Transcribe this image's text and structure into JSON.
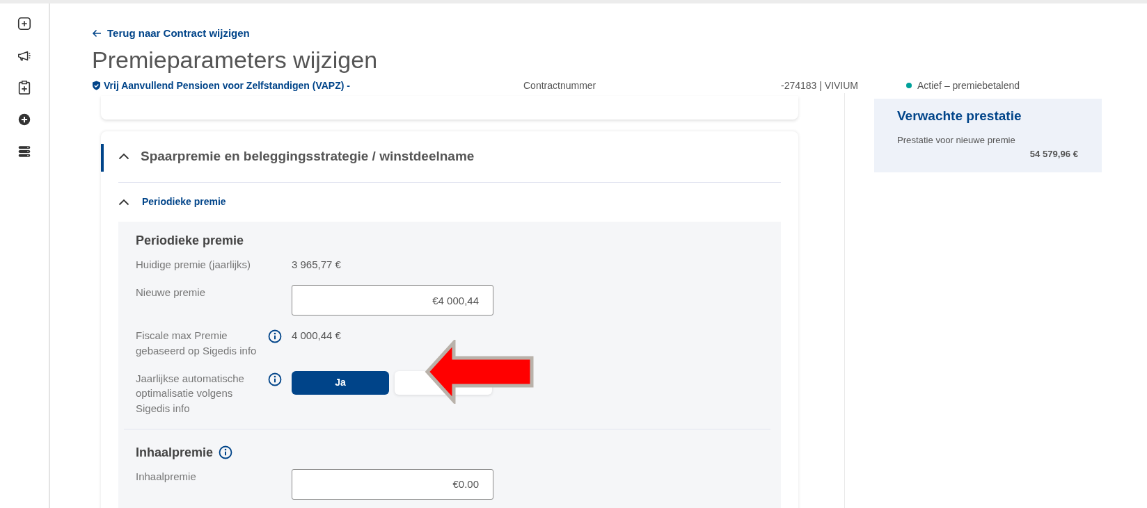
{
  "back_link": "Terug naar Contract wijzigen",
  "title": "Premieparameters wijzigen",
  "contract": {
    "product": "Vrij Aanvullend Pensioen voor Zelfstandigen (VAPZ) -",
    "number_label": "Contractnummer",
    "number": "-274183 | VIVIUM",
    "status": {
      "label": "Actief – premiebetalend",
      "color": "#00a19a"
    }
  },
  "section": {
    "title": "Spaarpremie en beleggingsstrategie / winstdeelname",
    "expanded": true,
    "subsection": {
      "title": "Periodieke premie",
      "expanded": true
    }
  },
  "periodic": {
    "heading": "Periodieke premie",
    "rows": [
      {
        "kind": "value",
        "label": "Huidige premie (jaarlijks)",
        "info": false,
        "value": "3 965,77 €"
      },
      {
        "kind": "input",
        "label": "Nieuwe premie",
        "info": false,
        "value": "€4 000,44"
      },
      {
        "kind": "value",
        "label": "Fiscale max Premie gebaseerd op Sigedis info",
        "info": true,
        "value": "4 000,44 €"
      },
      {
        "kind": "toggle",
        "label": "Jaarlijkse automatische optimalisatie volgens Sigedis info",
        "info": true,
        "options": [
          {
            "label": "Ja",
            "selected": true
          },
          {
            "selected": false
          }
        ]
      }
    ]
  },
  "catchup": {
    "heading": "Inhaalpremie",
    "info": true,
    "rows": [
      {
        "kind": "input",
        "label": "Inhaalpremie",
        "info": false,
        "value": "€0.00"
      }
    ]
  },
  "expected": {
    "title": "Verwachte prestatie",
    "label": "Prestatie voor nieuwe premie",
    "value": "54 579,96 €"
  }
}
